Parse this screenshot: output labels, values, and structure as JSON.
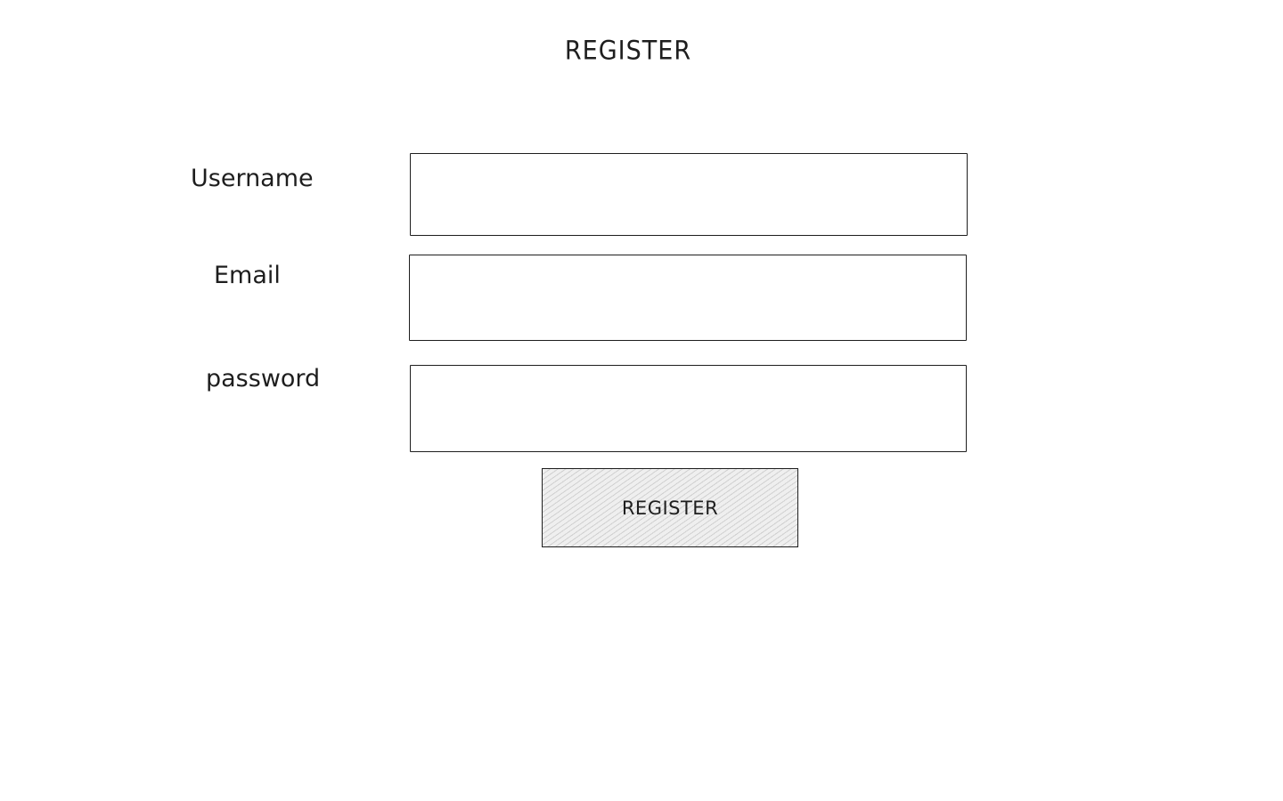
{
  "header": {
    "title": "REGISTER"
  },
  "form": {
    "username": {
      "label": "Username",
      "value": ""
    },
    "email": {
      "label": "Email",
      "value": ""
    },
    "password": {
      "label": "password",
      "value": ""
    },
    "submit_label": "REGISTER"
  }
}
